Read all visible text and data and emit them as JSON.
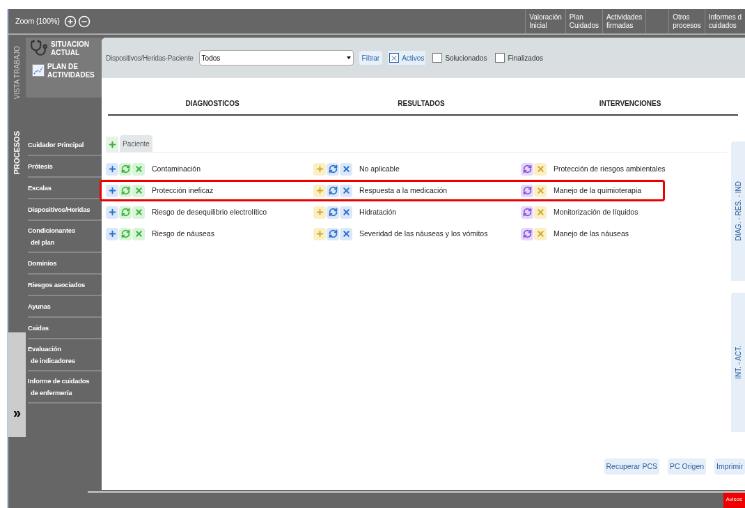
{
  "zoom": {
    "label": "Zoom {100%}"
  },
  "top_tabs": [
    {
      "lines": [
        "Valoración",
        "Inicial"
      ]
    },
    {
      "lines": [
        "Plan",
        "Cuidados"
      ]
    },
    {
      "lines": [
        "Actividades",
        "firmadas"
      ]
    },
    {
      "kind": "blank"
    },
    {
      "lines": [
        "Otros",
        "procesos"
      ]
    },
    {
      "lines": [
        "Informes d",
        "cuidados"
      ]
    }
  ],
  "rail": {
    "top_label": "VISTA TRABAJO",
    "bottom_label": "PROCESOS",
    "expand": "»"
  },
  "views": [
    {
      "kind": "stethoscope",
      "lines": [
        "SITUACION",
        "ACTUAL"
      ]
    },
    {
      "kind": "plan",
      "lines": [
        "PLAN DE",
        "ACTIVIDADES"
      ]
    }
  ],
  "menu": [
    {
      "lines": [
        "Cuidador Principal"
      ]
    },
    {
      "lines": [
        "Prótesis"
      ]
    },
    {
      "lines": [
        "Escalas"
      ]
    },
    {
      "lines": [
        "Dispositivos/Heridas"
      ]
    },
    {
      "lines": [
        "Condicionantes",
        "del plan"
      ]
    },
    {
      "lines": [
        "Dominios"
      ]
    },
    {
      "lines": [
        "Riesgos asociados"
      ]
    },
    {
      "lines": [
        "Ayunas"
      ]
    },
    {
      "lines": [
        "Caidas"
      ]
    },
    {
      "lines": [
        "Evaluación",
        "de indicadores"
      ]
    },
    {
      "lines": [
        "Informe de cuidados",
        "de enfermería"
      ]
    }
  ],
  "filter": {
    "label": "Dispositivos/Heridas-Paciente",
    "select_value": "Todos",
    "filter_button": "Filtrar",
    "checks": [
      {
        "label": "Activos",
        "checked": true
      },
      {
        "label": "Solucionados",
        "checked": false
      },
      {
        "label": "Finalizados",
        "checked": false
      }
    ]
  },
  "columns": [
    "DIAGNOSTICOS",
    "RESULTADOS",
    "INTERVENCIONES"
  ],
  "tab": {
    "label": "Paciente"
  },
  "rows": [
    {
      "diagnostic": "Contaminación",
      "result": "No aplicable",
      "intervention": "Protección de riesgos ambientales",
      "highlighted": false
    },
    {
      "diagnostic": "Protección ineficaz",
      "result": "Respuesta a la medicación",
      "intervention": "Manejo de la quimioterapia",
      "highlighted": true
    },
    {
      "diagnostic": "Riesgo de desequilibrio electrolítico",
      "result": "Hidratación",
      "intervention": "Monitorización de líquidos",
      "highlighted": false
    },
    {
      "diagnostic": "Riesgo de náuseas",
      "result": "Severidad de las náuseas y los vómitos",
      "intervention": "Manejo de las náuseas",
      "highlighted": false
    }
  ],
  "side_tabs": [
    "DIAG. - RES. - IND",
    "INT. - ACT."
  ],
  "buttons": [
    "Recuperar PCS",
    "PC Origen",
    "Imprimir"
  ],
  "alert": {
    "label": "Avisos"
  }
}
